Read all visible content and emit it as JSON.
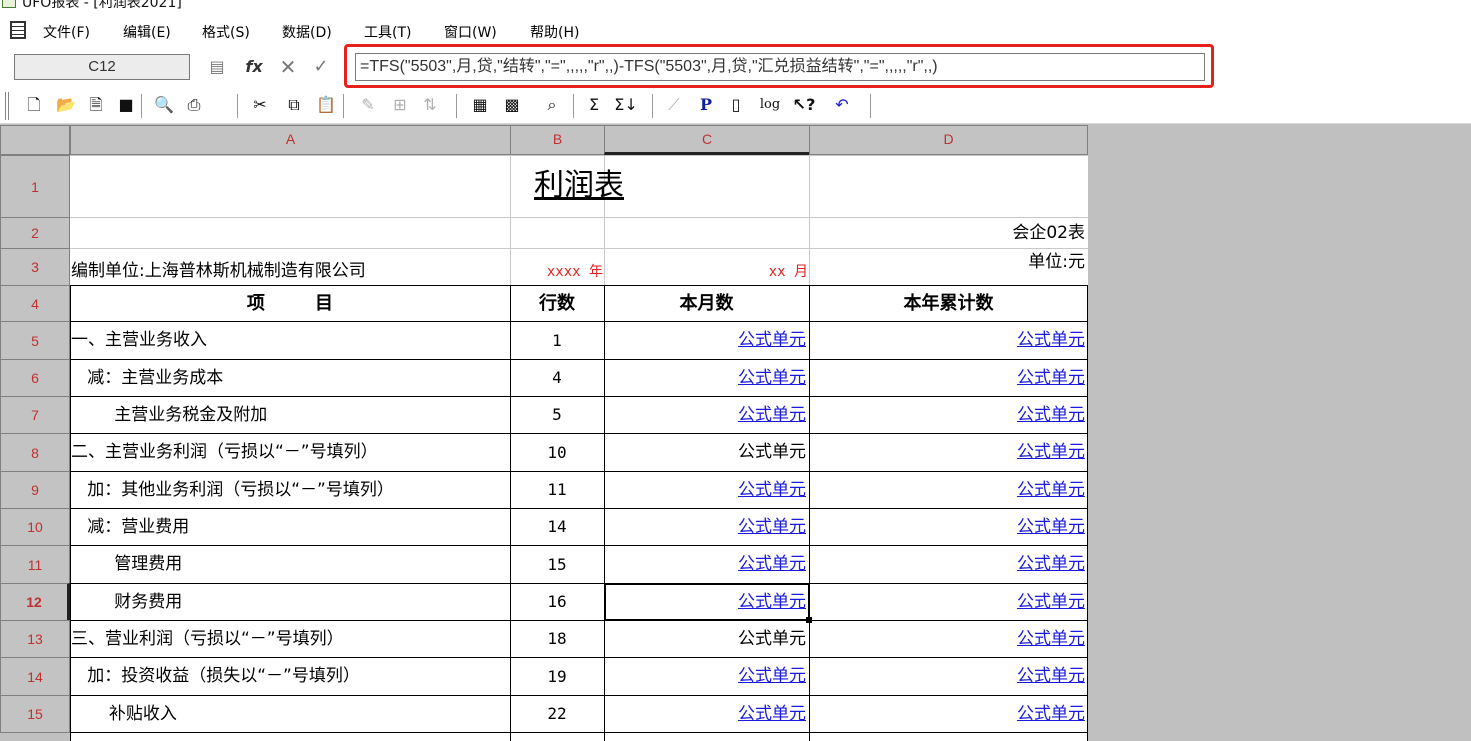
{
  "window": {
    "title": "UFO报表 - [利润表2021]"
  },
  "menu": {
    "items": [
      "文件(F)",
      "编辑(E)",
      "格式(S)",
      "数据(D)",
      "工具(T)",
      "窗口(W)",
      "帮助(H)"
    ]
  },
  "formula_bar": {
    "cell_ref": "C12",
    "formula": "=TFS(\"5503\",月,贷,\"结转\",\"=\",,,,,\"r\",,)-TFS(\"5503\",月,贷,\"汇兑损益结转\",\"=\",,,,,\"r\",,)",
    "highlight_color": "#e8201c"
  },
  "toolbar": {
    "icons": [
      "new-icon",
      "open-icon",
      "preview-doc-icon",
      "save-icon",
      "print-preview-icon",
      "print-icon",
      "cut-icon",
      "copy-icon",
      "paste-icon",
      "format-painter-icon",
      "insert-icon",
      "sort-icon",
      "table-icon",
      "grid-icon",
      "find-icon",
      "sum-icon",
      "sum-down-icon",
      "chart-icon",
      "p-icon",
      "calc-icon",
      "log-icon",
      "help-icon",
      "undo-icon"
    ]
  },
  "sheet": {
    "columns": [
      "A",
      "B",
      "C",
      "D"
    ],
    "active_column": "C",
    "active_row": "12",
    "rows": [
      {
        "num": "1",
        "a": "利润表",
        "b": "",
        "c": "",
        "d": ""
      },
      {
        "num": "2",
        "a": "",
        "b": "",
        "c": "",
        "d": "会企02表"
      },
      {
        "num": "3",
        "a": "编制单位:上海普林斯机械制造有限公司",
        "b": "xxxx 年",
        "c": "xx 月",
        "d": "单位:元"
      },
      {
        "num": "4",
        "a": "项        目",
        "b": "行数",
        "c": "本月数",
        "d": "本年累计数"
      },
      {
        "num": "5",
        "a": "一、主营业务收入",
        "b": "1",
        "c": "公式单元",
        "d": "公式单元"
      },
      {
        "num": "6",
        "a": "   减：主营业务成本",
        "b": "4",
        "c": "公式单元",
        "d": "公式单元"
      },
      {
        "num": "7",
        "a": "        主营业务税金及附加",
        "b": "5",
        "c": "公式单元",
        "d": "公式单元"
      },
      {
        "num": "8",
        "a": "二、主营业务利润（亏损以“－”号填列）",
        "b": "10",
        "c": "公式单元",
        "d": "公式单元"
      },
      {
        "num": "9",
        "a": "   加：其他业务利润（亏损以“－”号填列）",
        "b": "11",
        "c": "公式单元",
        "d": "公式单元"
      },
      {
        "num": "10",
        "a": "   减：营业费用",
        "b": "14",
        "c": "公式单元",
        "d": "公式单元"
      },
      {
        "num": "11",
        "a": "        管理费用",
        "b": "15",
        "c": "公式单元",
        "d": "公式单元"
      },
      {
        "num": "12",
        "a": "        财务费用",
        "b": "16",
        "c": "公式单元",
        "d": "公式单元"
      },
      {
        "num": "13",
        "a": "三、营业利润（亏损以“－”号填列）",
        "b": "18",
        "c": "公式单元",
        "d": "公式单元"
      },
      {
        "num": "14",
        "a": "   加：投资收益（损失以“－”号填列）",
        "b": "19",
        "c": "公式单元",
        "d": "公式单元"
      },
      {
        "num": "15",
        "a": "       补贴收入",
        "b": "22",
        "c": "公式单元",
        "d": "公式单元"
      }
    ]
  }
}
